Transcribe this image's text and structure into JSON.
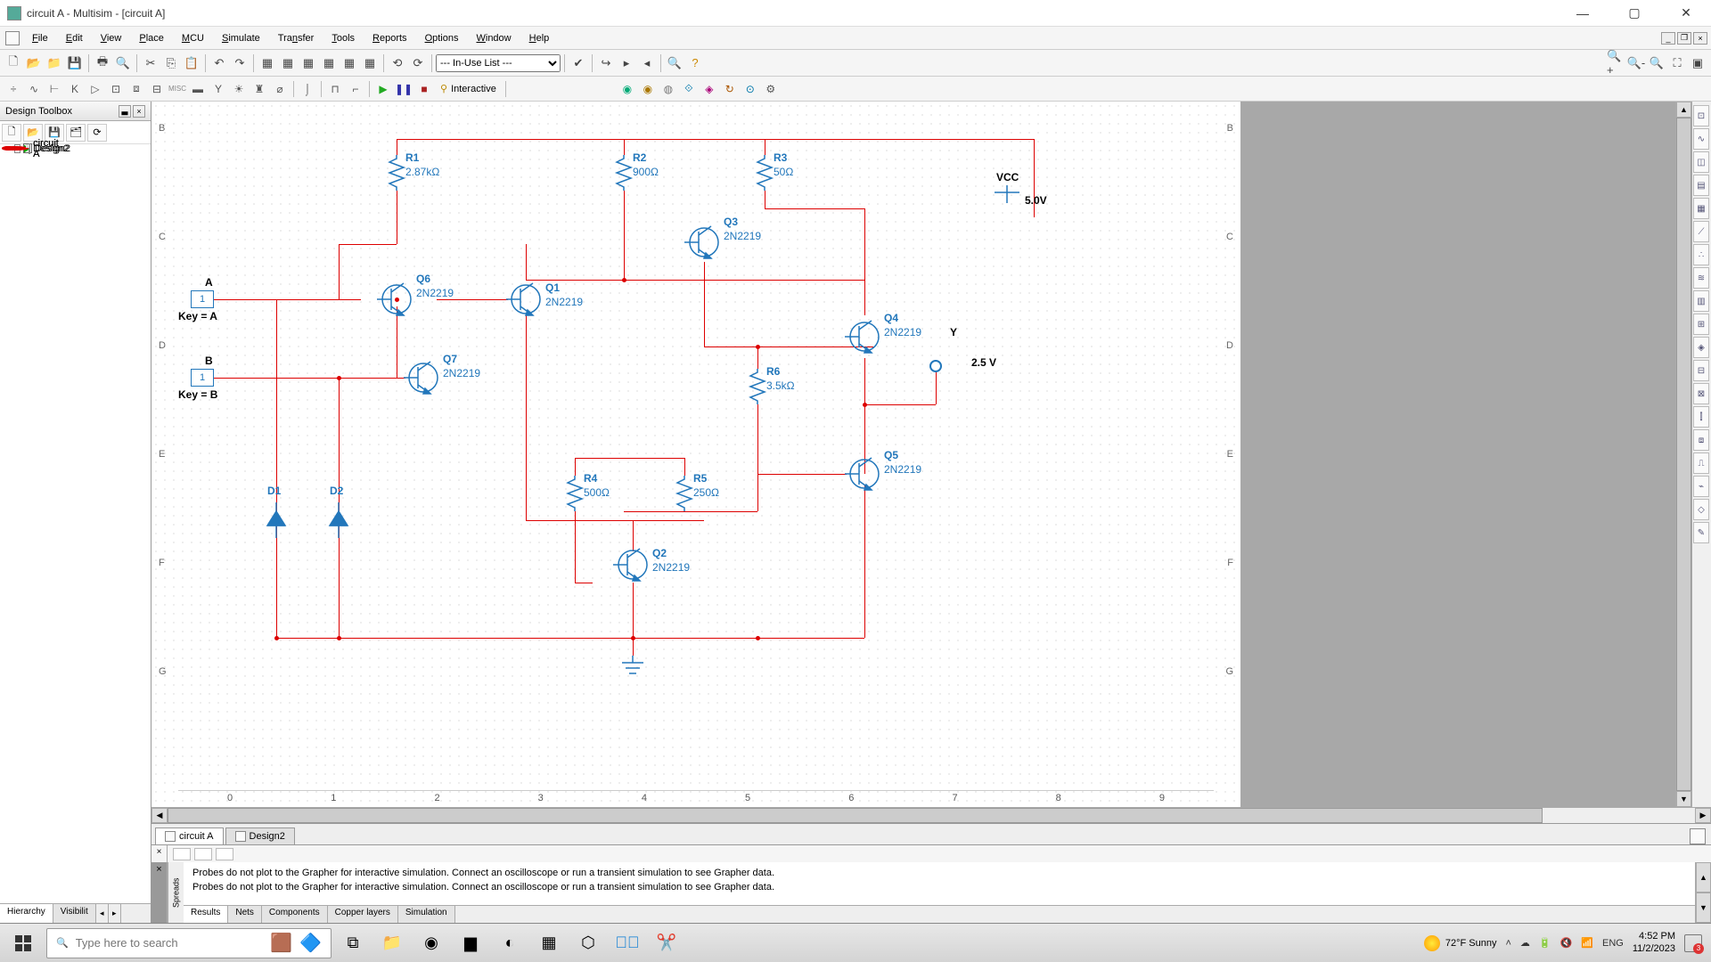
{
  "window": {
    "title": "circuit A - Multisim - [circuit A]"
  },
  "menu": {
    "items": [
      "File",
      "Edit",
      "View",
      "Place",
      "MCU",
      "Simulate",
      "Transfer",
      "Tools",
      "Reports",
      "Options",
      "Window",
      "Help"
    ]
  },
  "toolbar": {
    "inuse": "--- In-Use List ---",
    "interactive": "Interactive"
  },
  "sidebar": {
    "title": "Design Toolbox",
    "tree": {
      "root1": "circuit A",
      "root1_doc": "circuit A",
      "root2": "Design2",
      "root2_doc": "Design2"
    },
    "tabs": {
      "t1": "Hierarchy",
      "t2": "Visibilit"
    }
  },
  "sheets": {
    "s1": "circuit A",
    "s2": "Design2"
  },
  "msgs": {
    "l1": "Probes do not plot to the Grapher for interactive simulation. Connect an oscilloscope or run a transient simulation to see Grapher data.",
    "l2": "Probes do not plot to the Grapher for interactive simulation. Connect an oscilloscope or run a transient simulation to see Grapher data.",
    "tabs": [
      "Results",
      "Nets",
      "Components",
      "Copper layers",
      "Simulation"
    ],
    "vlabel": "Spreads"
  },
  "schematic": {
    "rows": [
      "B",
      "C",
      "D",
      "E",
      "F",
      "G"
    ],
    "cols": [
      "0",
      "1",
      "2",
      "3",
      "4",
      "5",
      "6",
      "7",
      "8",
      "9"
    ],
    "components": {
      "R1": {
        "name": "R1",
        "val": "2.87kΩ"
      },
      "R2": {
        "name": "R2",
        "val": "900Ω"
      },
      "R3": {
        "name": "R3",
        "val": "50Ω"
      },
      "R4": {
        "name": "R4",
        "val": "500Ω"
      },
      "R5": {
        "name": "R5",
        "val": "250Ω"
      },
      "R6": {
        "name": "R6",
        "val": "3.5kΩ"
      },
      "Q1": {
        "name": "Q1",
        "val": "2N2219"
      },
      "Q2": {
        "name": "Q2",
        "val": "2N2219"
      },
      "Q3": {
        "name": "Q3",
        "val": "2N2219"
      },
      "Q4": {
        "name": "Q4",
        "val": "2N2219"
      },
      "Q5": {
        "name": "Q5",
        "val": "2N2219"
      },
      "Q6": {
        "name": "Q6",
        "val": "2N2219"
      },
      "Q7": {
        "name": "Q7",
        "val": "2N2219"
      },
      "D1": "D1",
      "D2": "D2",
      "A": {
        "lbl": "A",
        "key": "Key = A",
        "val": "1"
      },
      "B": {
        "lbl": "B",
        "key": "Key = B",
        "val": "1"
      },
      "VCC": {
        "lbl": "VCC",
        "val": "5.0V"
      },
      "Y": "Y",
      "Yval": "2.5 V"
    }
  },
  "taskbar": {
    "search_ph": "Type here to search",
    "weather": "72°F  Sunny",
    "lang": "ENG",
    "time": "4:52 PM",
    "date": "11/2/2023"
  }
}
